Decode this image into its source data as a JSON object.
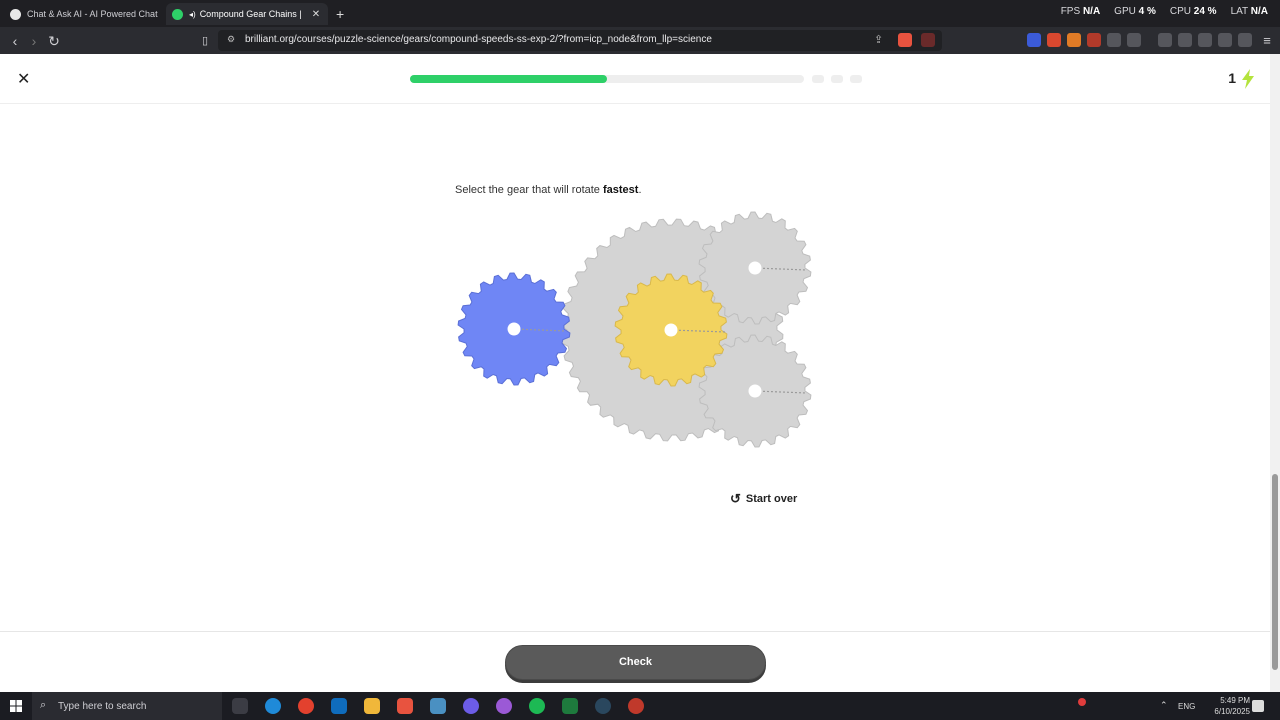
{
  "browser": {
    "tabs": [
      {
        "title": "Chat & Ask AI - AI Powered Chat Bot",
        "active": false
      },
      {
        "title": "Compound Gear Chains | Brilli",
        "active": true
      }
    ],
    "new_tab": "+",
    "perf": {
      "fps_label": "FPS",
      "fps_value": "N/A",
      "gpu_label": "GPU",
      "gpu_value": "4 %",
      "cpu_label": "CPU",
      "cpu_value": "24 %",
      "lat_label": "LAT",
      "lat_value": "N/A"
    },
    "url": "brilliant.org/courses/puzzle-science/gears/compound-speeds-ss-exp-2/?from=icp_node&from_llp=science"
  },
  "lesson": {
    "progress_fraction": 0.5,
    "remaining_segments": 3,
    "streak_count": "1",
    "question_prefix": "Select the gear that will rotate ",
    "question_emphasis": "fastest",
    "question_suffix": ".",
    "start_over_label": "Start over",
    "check_label": "Check"
  },
  "gears": {
    "blue_color": "#6f86f5",
    "yellow_color": "#f2d35f",
    "gray_color": "#d4d4d4"
  },
  "taskbar": {
    "search_placeholder": "Type here to search",
    "lang": "ENG",
    "time": "5:49 PM",
    "date": "6/10/2025"
  }
}
